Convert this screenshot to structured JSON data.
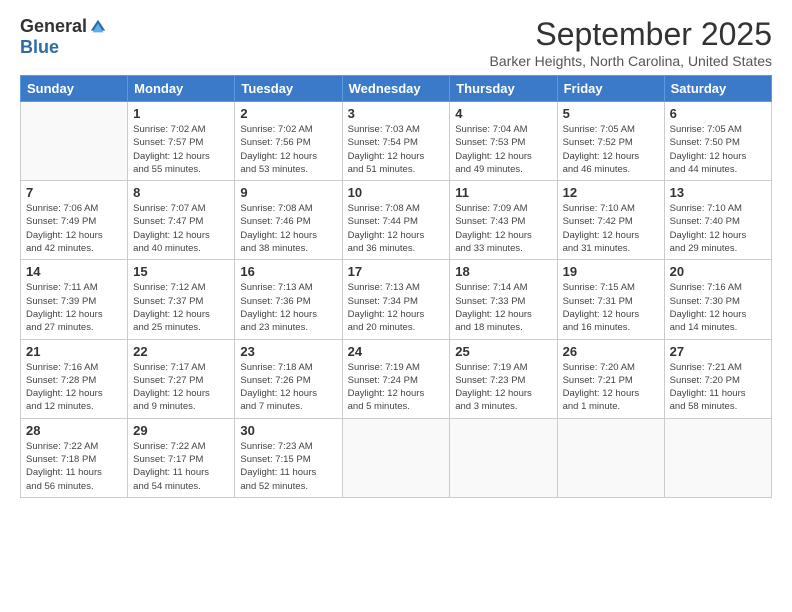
{
  "header": {
    "logo_general": "General",
    "logo_blue": "Blue",
    "month": "September 2025",
    "location": "Barker Heights, North Carolina, United States"
  },
  "days_of_week": [
    "Sunday",
    "Monday",
    "Tuesday",
    "Wednesday",
    "Thursday",
    "Friday",
    "Saturday"
  ],
  "weeks": [
    [
      {
        "day": "",
        "info": ""
      },
      {
        "day": "1",
        "info": "Sunrise: 7:02 AM\nSunset: 7:57 PM\nDaylight: 12 hours\nand 55 minutes."
      },
      {
        "day": "2",
        "info": "Sunrise: 7:02 AM\nSunset: 7:56 PM\nDaylight: 12 hours\nand 53 minutes."
      },
      {
        "day": "3",
        "info": "Sunrise: 7:03 AM\nSunset: 7:54 PM\nDaylight: 12 hours\nand 51 minutes."
      },
      {
        "day": "4",
        "info": "Sunrise: 7:04 AM\nSunset: 7:53 PM\nDaylight: 12 hours\nand 49 minutes."
      },
      {
        "day": "5",
        "info": "Sunrise: 7:05 AM\nSunset: 7:52 PM\nDaylight: 12 hours\nand 46 minutes."
      },
      {
        "day": "6",
        "info": "Sunrise: 7:05 AM\nSunset: 7:50 PM\nDaylight: 12 hours\nand 44 minutes."
      }
    ],
    [
      {
        "day": "7",
        "info": "Sunrise: 7:06 AM\nSunset: 7:49 PM\nDaylight: 12 hours\nand 42 minutes."
      },
      {
        "day": "8",
        "info": "Sunrise: 7:07 AM\nSunset: 7:47 PM\nDaylight: 12 hours\nand 40 minutes."
      },
      {
        "day": "9",
        "info": "Sunrise: 7:08 AM\nSunset: 7:46 PM\nDaylight: 12 hours\nand 38 minutes."
      },
      {
        "day": "10",
        "info": "Sunrise: 7:08 AM\nSunset: 7:44 PM\nDaylight: 12 hours\nand 36 minutes."
      },
      {
        "day": "11",
        "info": "Sunrise: 7:09 AM\nSunset: 7:43 PM\nDaylight: 12 hours\nand 33 minutes."
      },
      {
        "day": "12",
        "info": "Sunrise: 7:10 AM\nSunset: 7:42 PM\nDaylight: 12 hours\nand 31 minutes."
      },
      {
        "day": "13",
        "info": "Sunrise: 7:10 AM\nSunset: 7:40 PM\nDaylight: 12 hours\nand 29 minutes."
      }
    ],
    [
      {
        "day": "14",
        "info": "Sunrise: 7:11 AM\nSunset: 7:39 PM\nDaylight: 12 hours\nand 27 minutes."
      },
      {
        "day": "15",
        "info": "Sunrise: 7:12 AM\nSunset: 7:37 PM\nDaylight: 12 hours\nand 25 minutes."
      },
      {
        "day": "16",
        "info": "Sunrise: 7:13 AM\nSunset: 7:36 PM\nDaylight: 12 hours\nand 23 minutes."
      },
      {
        "day": "17",
        "info": "Sunrise: 7:13 AM\nSunset: 7:34 PM\nDaylight: 12 hours\nand 20 minutes."
      },
      {
        "day": "18",
        "info": "Sunrise: 7:14 AM\nSunset: 7:33 PM\nDaylight: 12 hours\nand 18 minutes."
      },
      {
        "day": "19",
        "info": "Sunrise: 7:15 AM\nSunset: 7:31 PM\nDaylight: 12 hours\nand 16 minutes."
      },
      {
        "day": "20",
        "info": "Sunrise: 7:16 AM\nSunset: 7:30 PM\nDaylight: 12 hours\nand 14 minutes."
      }
    ],
    [
      {
        "day": "21",
        "info": "Sunrise: 7:16 AM\nSunset: 7:28 PM\nDaylight: 12 hours\nand 12 minutes."
      },
      {
        "day": "22",
        "info": "Sunrise: 7:17 AM\nSunset: 7:27 PM\nDaylight: 12 hours\nand 9 minutes."
      },
      {
        "day": "23",
        "info": "Sunrise: 7:18 AM\nSunset: 7:26 PM\nDaylight: 12 hours\nand 7 minutes."
      },
      {
        "day": "24",
        "info": "Sunrise: 7:19 AM\nSunset: 7:24 PM\nDaylight: 12 hours\nand 5 minutes."
      },
      {
        "day": "25",
        "info": "Sunrise: 7:19 AM\nSunset: 7:23 PM\nDaylight: 12 hours\nand 3 minutes."
      },
      {
        "day": "26",
        "info": "Sunrise: 7:20 AM\nSunset: 7:21 PM\nDaylight: 12 hours\nand 1 minute."
      },
      {
        "day": "27",
        "info": "Sunrise: 7:21 AM\nSunset: 7:20 PM\nDaylight: 11 hours\nand 58 minutes."
      }
    ],
    [
      {
        "day": "28",
        "info": "Sunrise: 7:22 AM\nSunset: 7:18 PM\nDaylight: 11 hours\nand 56 minutes."
      },
      {
        "day": "29",
        "info": "Sunrise: 7:22 AM\nSunset: 7:17 PM\nDaylight: 11 hours\nand 54 minutes."
      },
      {
        "day": "30",
        "info": "Sunrise: 7:23 AM\nSunset: 7:15 PM\nDaylight: 11 hours\nand 52 minutes."
      },
      {
        "day": "",
        "info": ""
      },
      {
        "day": "",
        "info": ""
      },
      {
        "day": "",
        "info": ""
      },
      {
        "day": "",
        "info": ""
      }
    ]
  ]
}
